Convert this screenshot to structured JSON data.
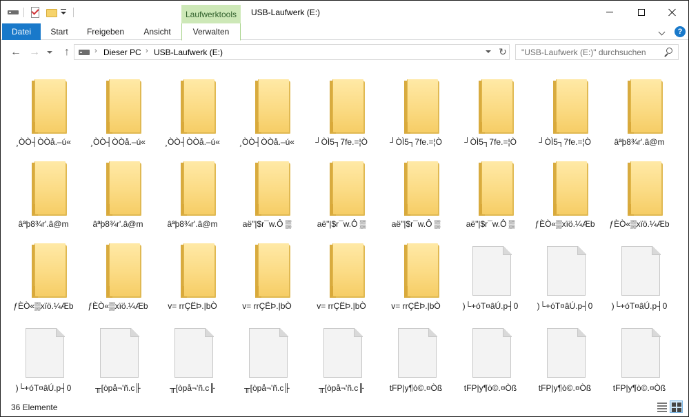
{
  "window": {
    "title": "USB-Laufwerk (E:)",
    "contextual_group": "Laufwerktools"
  },
  "ribbon": {
    "tabs": [
      {
        "label": "Datei"
      },
      {
        "label": "Start"
      },
      {
        "label": "Freigeben"
      },
      {
        "label": "Ansicht"
      },
      {
        "label": "Verwalten"
      }
    ],
    "help_glyph": "?"
  },
  "navigation": {
    "back_glyph": "←",
    "forward_glyph": "→",
    "up_glyph": "↑",
    "refresh_glyph": "↻",
    "breadcrumb": [
      "Dieser PC",
      "USB-Laufwerk (E:)"
    ],
    "breadcrumb_separator": "›",
    "search_placeholder": "\"USB-Laufwerk (E:)\" durchsuchen"
  },
  "items": [
    {
      "name": "¸ÒÒ┤ÒÒå.–ú«",
      "type": "folder"
    },
    {
      "name": "¸ÒÒ┤ÒÒå.–ú«",
      "type": "folder"
    },
    {
      "name": "¸ÒÒ┤ÒÒå.–ú«",
      "type": "folder"
    },
    {
      "name": "¸ÒÒ┤ÒÒå.–ú«",
      "type": "folder"
    },
    {
      "name": "┘ÒÌ5┐7fe.=¦Ò",
      "type": "folder"
    },
    {
      "name": "┘ÒÌ5┐7fe.=¦Ò",
      "type": "folder"
    },
    {
      "name": "┘ÒÌ5┐7fe.=¦Ò",
      "type": "folder"
    },
    {
      "name": "┘ÒÌ5┐7fe.=¦Ò",
      "type": "folder"
    },
    {
      "name": "âªþ8¾r'.â@m",
      "type": "folder"
    },
    {
      "name": "âªþ8¾r'.â@m",
      "type": "folder"
    },
    {
      "name": "âªþ8¾r'.â@m",
      "type": "folder"
    },
    {
      "name": "âªþ8¾r'.â@m",
      "type": "folder"
    },
    {
      "name": "aë\"|$r¯w.Ô ▒",
      "type": "folder"
    },
    {
      "name": "aë\"|$r¯w.Ô ▒",
      "type": "folder"
    },
    {
      "name": "aë\"|$r¯w.Ô ▒",
      "type": "folder"
    },
    {
      "name": "aë\"|$r¯w.Ô ▒",
      "type": "folder"
    },
    {
      "name": "ƒÈÒ«▒xïö.¼Æb",
      "type": "folder"
    },
    {
      "name": "ƒÈÒ«▒xïö.¼Æb",
      "type": "folder"
    },
    {
      "name": "ƒÈÒ«▒xïö.¼Æb",
      "type": "folder"
    },
    {
      "name": "ƒÈÒ«▒xïö.¼Æb",
      "type": "folder"
    },
    {
      "name": "v= rrÇËÞ.|bÒ",
      "type": "folder"
    },
    {
      "name": "v= rrÇËÞ.|bÒ",
      "type": "folder"
    },
    {
      "name": "v= rrÇËÞ.|bÒ",
      "type": "folder"
    },
    {
      "name": "v= rrÇËÞ.|bÒ",
      "type": "folder"
    },
    {
      "name": ")└+óT¤âÚ.p┤0",
      "type": "file"
    },
    {
      "name": ")└+óT¤âÚ.p┤0",
      "type": "file"
    },
    {
      "name": ")└+óT¤âÚ.p┤0",
      "type": "file"
    },
    {
      "name": ")└+óT¤âÚ.p┤0",
      "type": "file"
    },
    {
      "name": "╥[òpå¬'ñ.c╟",
      "type": "file"
    },
    {
      "name": "╥[òpå¬'ñ.c╟",
      "type": "file"
    },
    {
      "name": "╥[òpå¬'ñ.c╟",
      "type": "file"
    },
    {
      "name": "╥[òpå¬'ñ.c╟",
      "type": "file"
    },
    {
      "name": "tFP|y¶ò©.¤Òß",
      "type": "file"
    },
    {
      "name": "tFP|y¶ò©.¤Òß",
      "type": "file"
    },
    {
      "name": "tFP|y¶ò©.¤Òß",
      "type": "file"
    },
    {
      "name": "tFP|y¶ò©.¤Òß",
      "type": "file"
    }
  ],
  "status": {
    "count_text": "36 Elemente"
  },
  "colors": {
    "datei_tab": "#1979ca",
    "contextual_tab": "#cde8b7",
    "folder": "#fbdb84"
  }
}
